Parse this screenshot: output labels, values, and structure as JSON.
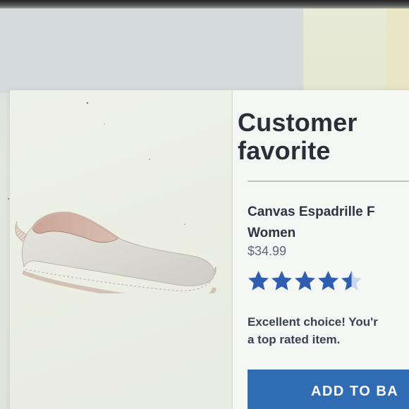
{
  "modal": {
    "title": "Customer\nfavorite",
    "product": {
      "name_line1": "Canvas Espadrille F",
      "name_line2": "Women",
      "price": "$34.99",
      "rating": 4.5,
      "rating_max": 5
    },
    "message_line1": "Excellent choice! You'r",
    "message_line2": "a top rated item.",
    "cta_label": "ADD TO BA"
  },
  "icons": {
    "product_image": "canvas-espadrille-shoe",
    "rating": "star-icon"
  },
  "colors": {
    "title_text": "#2b2e36",
    "price_text": "#616774",
    "star_fill": "#2f5db0",
    "star_empty": "#c9d6ee",
    "cta_background": "#2f6cb4",
    "cta_text": "#ffffff"
  }
}
